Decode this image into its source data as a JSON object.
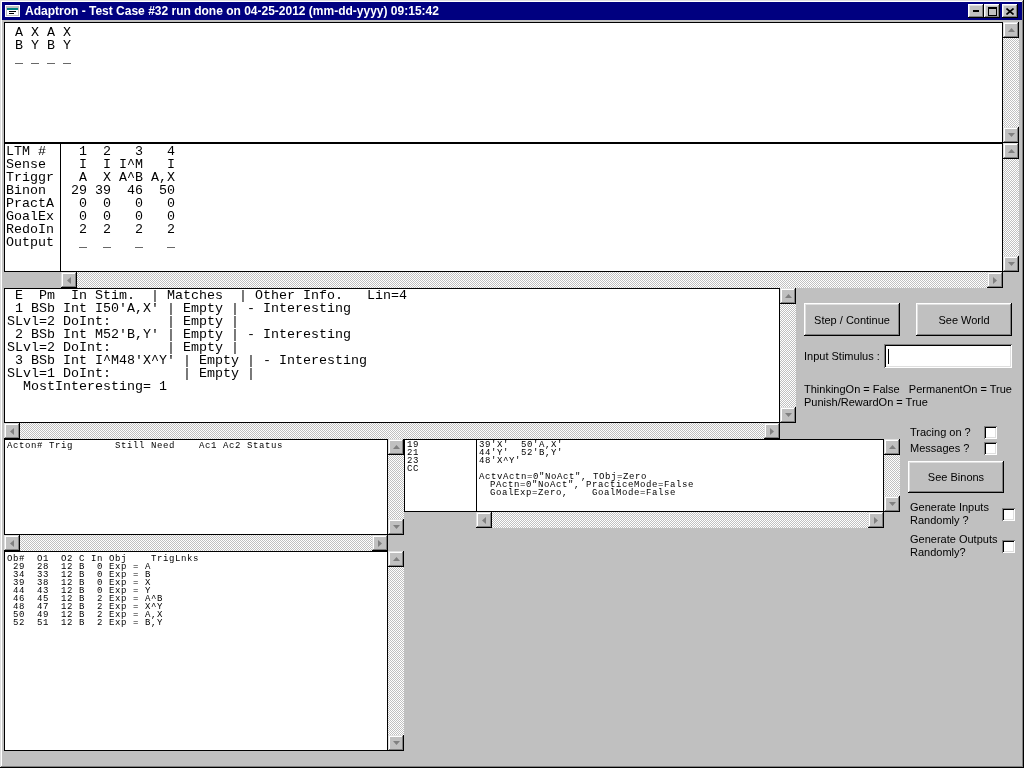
{
  "window": {
    "title": "Adaptron - Test Case #32 run done on 04-25-2012 (mm-dd-yyyy) 09:15:42"
  },
  "world_panel": {
    "lines": [
      "A X A X",
      "B Y B Y",
      "_ _ _ _"
    ]
  },
  "ltm_table": {
    "rows": [
      {
        "label": "LTM #",
        "values": [
          "1",
          "2",
          "3",
          "4"
        ]
      },
      {
        "label": "Sense",
        "values": [
          "I",
          "I",
          "I^M",
          "I"
        ]
      },
      {
        "label": "Triggr",
        "values": [
          "A",
          "X",
          "A^B",
          "A,X"
        ]
      },
      {
        "label": "Binon",
        "values": [
          "29",
          "39",
          "46",
          "50"
        ]
      },
      {
        "label": "PractA",
        "values": [
          "0",
          "0",
          "0",
          "0"
        ]
      },
      {
        "label": "GoalEx",
        "values": [
          "0",
          "0",
          "0",
          "0"
        ]
      },
      {
        "label": "RedoIn",
        "values": [
          "2",
          "2",
          "2",
          "2"
        ]
      },
      {
        "label": "Output",
        "values": [
          "_",
          "_",
          "_",
          "_"
        ]
      }
    ]
  },
  "stimulus_panel": {
    "lines": [
      " E  Pm  In Stim.  | Matches  | Other Info.   Lin=4",
      " 1 BSb Int I50'A,X' | Empty | - Interesting",
      "SLvl=2 DoInt:       | Empty |",
      " 2 BSb Int M52'B,Y' | Empty | - Interesting",
      "SLvl=2 DoInt:       | Empty |",
      " 3 BSb Int I^M48'X^Y' | Empty | - Interesting",
      "SLvl=1 DoInt:         | Empty |",
      "  MostInteresting= 1"
    ]
  },
  "action_buttons": [
    {
      "label": "Step / Continue"
    },
    {
      "label": "See World"
    }
  ],
  "input_stimulus": {
    "label": "Input Stimulus :",
    "focused": true
  },
  "status_lines": [
    "ThinkingOn = False   PermanentOn = True",
    "Punish/RewardOn = True"
  ],
  "trace_options": [
    {
      "label": "Tracing on ?",
      "checked": false
    },
    {
      "label": "Messages ?",
      "checked": false
    }
  ],
  "binons_button": {
    "label": "See Binons"
  },
  "random_options": [
    {
      "label": "Generate Inputs Randomly ?",
      "checked": false
    },
    {
      "label": "Generate Outputs Randomly?",
      "checked": false
    }
  ],
  "acton_panel": {
    "lines": [
      "Acton# Trig       Still Need    Ac1 Ac2 Status"
    ]
  },
  "object_panel": {
    "lines": [
      "Ob#  O1  O2 C In Obj    TrigLnks",
      " 29  28  12 B  0 Exp = A",
      " 34  33  12 B  0 Exp = B",
      " 39  38  12 B  0 Exp = X",
      " 44  43  12 B  0 Exp = Y",
      " 46  45  12 B  2 Exp = A^B",
      " 48  47  12 B  2 Exp = X^Y",
      " 50  49  12 B  2 Exp = A,X",
      " 52  51  12 B  2 Exp = B,Y"
    ]
  },
  "trigger_panel": {
    "numbers": [
      "19",
      "21",
      "23",
      "CC"
    ],
    "links": [
      "39'X'  50'A,X'",
      "44'Y'  52'B,Y'",
      "48'X^Y'"
    ],
    "status": [
      "ActvActn=0\"NoAct\", TObj=Zero",
      "PActn=0\"NoAct\", PracticeMode=False",
      "GoalExp=Zero,    GoalMode=False"
    ]
  }
}
